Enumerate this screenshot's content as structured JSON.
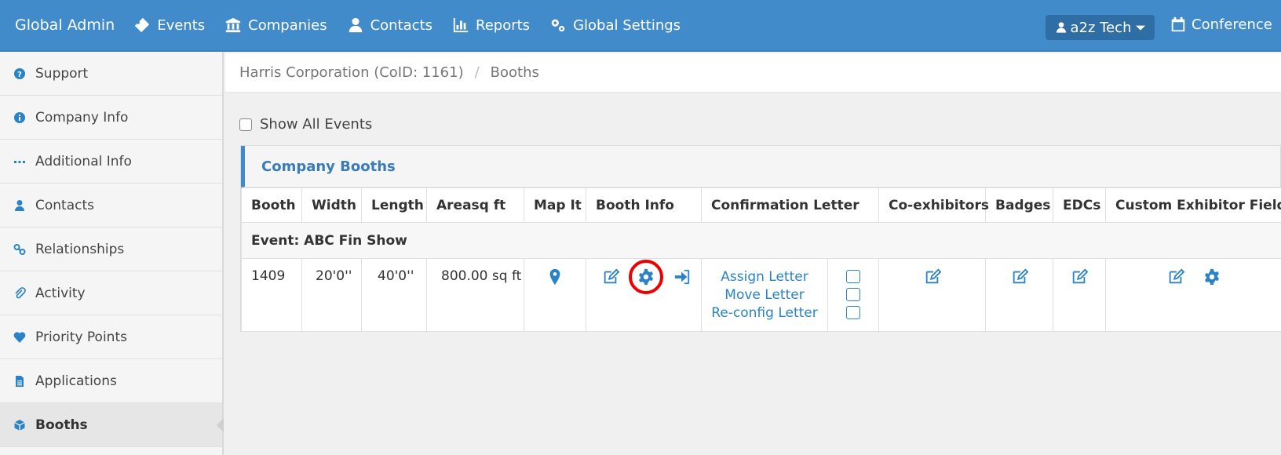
{
  "header": {
    "brand": "Global Admin",
    "nav": [
      {
        "label": "Events",
        "icon": "ticket-icon"
      },
      {
        "label": "Companies",
        "icon": "bank-icon"
      },
      {
        "label": "Contacts",
        "icon": "user-icon"
      },
      {
        "label": "Reports",
        "icon": "bar-chart-icon"
      },
      {
        "label": "Global Settings",
        "icon": "gears-icon"
      }
    ],
    "user": "a2z Tech",
    "conference": "Conference"
  },
  "sidebar": {
    "items": [
      {
        "label": "Support",
        "icon": "question-icon"
      },
      {
        "label": "Company Info",
        "icon": "info-icon"
      },
      {
        "label": "Additional Info",
        "icon": "ellipsis-icon"
      },
      {
        "label": "Contacts",
        "icon": "user-icon"
      },
      {
        "label": "Relationships",
        "icon": "link-icon"
      },
      {
        "label": "Activity",
        "icon": "paperclip-icon"
      },
      {
        "label": "Priority Points",
        "icon": "heart-icon"
      },
      {
        "label": "Applications",
        "icon": "document-icon"
      },
      {
        "label": "Booths",
        "icon": "cube-icon",
        "active": true
      }
    ]
  },
  "breadcrumb": {
    "company": "Harris Corporation (CoID: 1161)",
    "separator": "/",
    "current": "Booths"
  },
  "filters": {
    "show_all_events": "Show All Events"
  },
  "panel": {
    "title": "Company Booths",
    "columns": [
      "Booth",
      "Width",
      "Length",
      "Areasq ft",
      "Map It",
      "Booth Info",
      "Confirmation Letter",
      "Co-exhibitors",
      "Badges",
      "EDCs",
      "Custom Exhibitor Fields"
    ],
    "event_label": "Event: ABC Fin Show",
    "rows": [
      {
        "booth": "1409",
        "width": "20'0''",
        "length": "40'0''",
        "area": "800.00 sq ft",
        "letters": [
          "Assign Letter",
          "Move Letter",
          "Re-config Letter"
        ]
      }
    ]
  },
  "colors": {
    "nav_bg": "#428bca",
    "accent": "#2a83c6",
    "highlight_ring": "#e00000"
  }
}
